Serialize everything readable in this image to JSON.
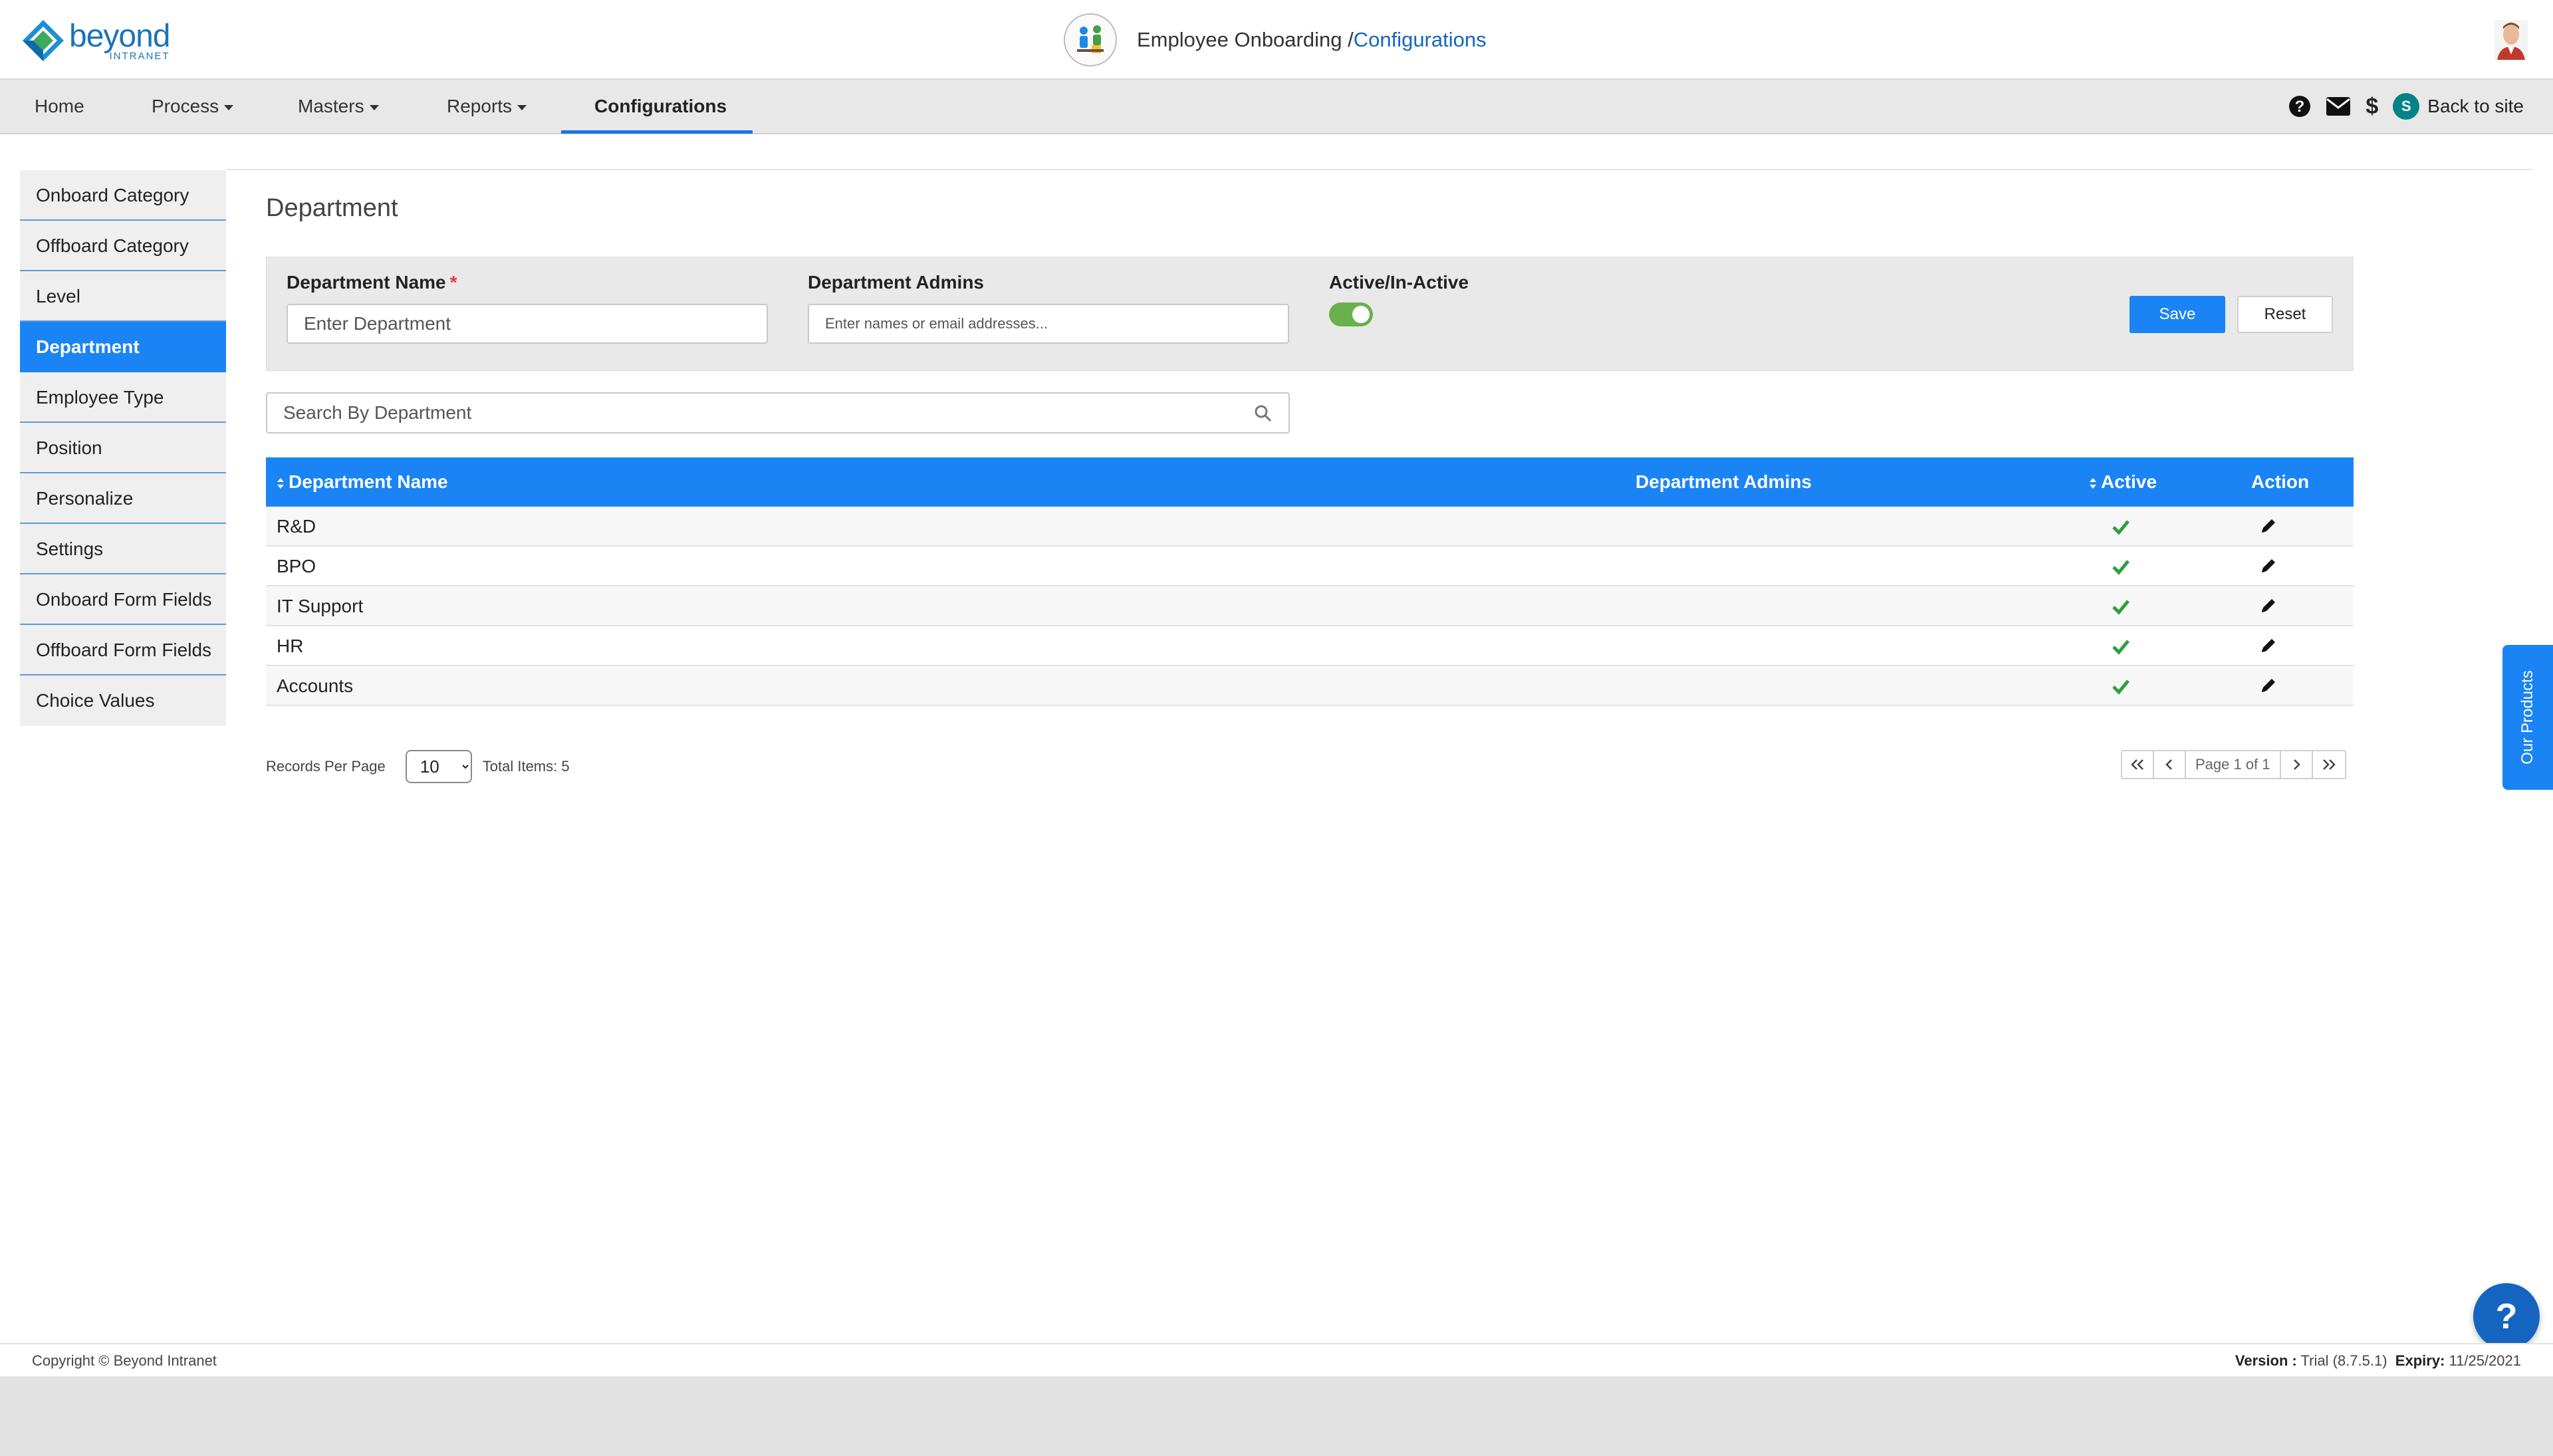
{
  "header": {
    "logo_main": "beyond",
    "logo_sub": "INTRANET",
    "app_name": "Employee Onboarding /",
    "app_crumb": "Configurations"
  },
  "nav": {
    "items": [
      {
        "label": "Home"
      },
      {
        "label": "Process"
      },
      {
        "label": "Masters"
      },
      {
        "label": "Reports"
      },
      {
        "label": "Configurations"
      }
    ],
    "back_to_site": "Back to site",
    "sharepoint_letter": "S",
    "dollar": "$"
  },
  "sidebar": {
    "items": [
      {
        "label": "Onboard Category"
      },
      {
        "label": "Offboard Category"
      },
      {
        "label": "Level"
      },
      {
        "label": "Department"
      },
      {
        "label": "Employee Type"
      },
      {
        "label": "Position"
      },
      {
        "label": "Personalize"
      },
      {
        "label": "Settings"
      },
      {
        "label": "Onboard Form Fields"
      },
      {
        "label": "Offboard Form Fields"
      },
      {
        "label": "Choice Values"
      }
    ],
    "active_index": 3
  },
  "main": {
    "title": "Department",
    "form": {
      "dept_name_label": "Department Name",
      "required_mark": "*",
      "dept_name_placeholder": "Enter Department",
      "dept_admins_label": "Department Admins",
      "dept_admins_placeholder": "Enter names or email addresses...",
      "active_label": "Active/In-Active",
      "active_value": true,
      "save_label": "Save",
      "reset_label": "Reset"
    },
    "search": {
      "placeholder": "Search By Department"
    },
    "table": {
      "columns": {
        "name": "Department Name",
        "admins": "Department Admins",
        "active": "Active",
        "action": "Action"
      },
      "rows": [
        {
          "name": "R&D",
          "admins": "",
          "active": true
        },
        {
          "name": "BPO",
          "admins": "",
          "active": true
        },
        {
          "name": "IT Support",
          "admins": "",
          "active": true
        },
        {
          "name": "HR",
          "admins": "",
          "active": true
        },
        {
          "name": "Accounts",
          "admins": "",
          "active": true
        }
      ]
    },
    "pager": {
      "records_label": "Records Per Page",
      "per_page": "10",
      "total_items": "Total Items: 5",
      "page_label": "Page 1 of 1"
    }
  },
  "side_tab": "Our Products",
  "help_label": "?",
  "footer": {
    "copyright": "Copyright © Beyond Intranet",
    "version_label": "Version :",
    "version_value": "Trial (8.7.5.1)",
    "expiry_label": "Expiry:",
    "expiry_value": "11/25/2021"
  },
  "colors": {
    "accent": "#1a84f5",
    "toggle_on": "#6ab04c",
    "check": "#2e9e3e"
  }
}
